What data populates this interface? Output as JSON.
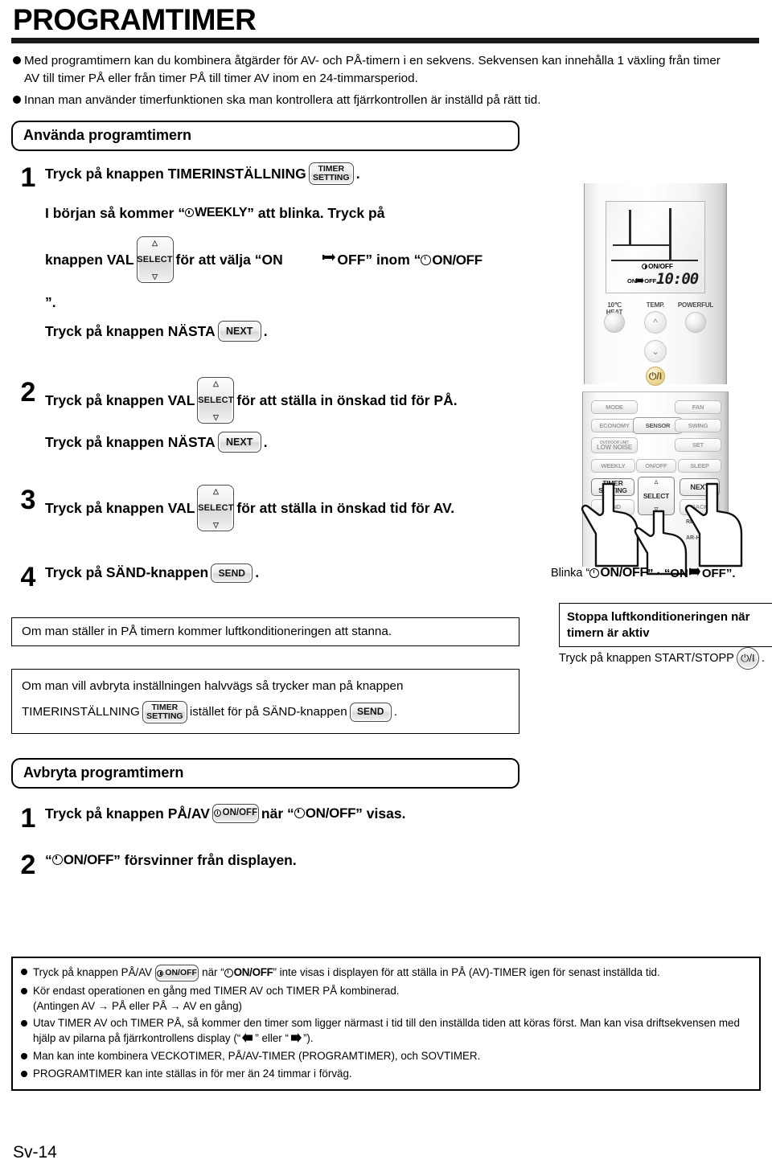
{
  "page": {
    "title": "PROGRAMTIMER",
    "footer": "Sv-14"
  },
  "intro": [
    "Med programtimern kan du kombinera åtgärder för AV- och PÅ-timern i en sekvens. Sekvensen kan innehålla 1 växling från timer AV till timer PÅ eller från timer PÅ till timer AV inom en 24-timmarsperiod.",
    "Innan man använder timerfunktionen ska man kontrollera att fjärrkontrollen är inställd på rätt tid."
  ],
  "use_section": {
    "heading": "Använda programtimern",
    "step1": {
      "num": "1",
      "line1_a": "Tryck på knappen TIMERINSTÄLLNING",
      "line1_b": ".",
      "line2_a": "I början så kommer “",
      "line2_weekly": "WEEKLY",
      "line2_b": "” att blinka. Tryck på",
      "line3_a": "knappen VAL",
      "line3_b": "för att välja “ON",
      "line3_c": "OFF” inom “",
      "line3_onoff": "ON/OFF",
      "line4": "”.",
      "line5_a": "Tryck på knappen NÄSTA",
      "line5_b": "."
    },
    "step2": {
      "num": "2",
      "line1_a": "Tryck på knappen VAL",
      "line1_b": "för att ställa in önskad tid för PÅ.",
      "line2_a": "Tryck på knappen NÄSTA",
      "line2_b": "."
    },
    "step3": {
      "num": "3",
      "line1_a": "Tryck på knappen VAL",
      "line1_b": "för att ställa in önskad tid för AV."
    },
    "step4": {
      "num": "4",
      "line1_a": "Tryck på SÄND-knappen",
      "line1_b": "."
    },
    "note_stop": "Om man ställer in PÅ timern kommer luftkonditioneringen att stanna.",
    "note_cancel_a": "Om man vill avbryta inställningen halvvägs så trycker man på knappen",
    "note_cancel_b": "TIMERINSTÄLLNING",
    "note_cancel_c": "istället för på SÄND-knappen",
    "note_cancel_d": "."
  },
  "right_panel": {
    "blinka_a": "Blinka “",
    "blinka_onoff": "ON/OFF",
    "blinka_b": "” · “ON",
    "blinka_c": "OFF”.",
    "stop_box_line1": "Stoppa luftkonditioneringen när",
    "stop_box_line2": "timern är aktiv",
    "start_stop_a": "Tryck på knappen START/STOPP",
    "start_stop_b": ".",
    "lcd": {
      "indicator_onoff": "ON/OFF",
      "mode_on": "ON",
      "mode_off": "OFF",
      "time": "10:00"
    },
    "remote_labels": {
      "heat10": "10℃ HEAT",
      "temp": "TEMP.",
      "powerful": "POWERFUL",
      "power_symbol": "⏻/I"
    },
    "buttons": [
      "MODE",
      "FAN",
      "ECONOMY",
      "SENSOR",
      "SWING",
      "OUTDOOR UNIT LOW NOISE",
      "SET",
      "WEEKLY",
      "ON/OFF",
      "SLEEP",
      "TIMER SETTING",
      "SELECT",
      "NEXT",
      "SEND",
      "BACK",
      "CLOCK ADJUST",
      "RESET",
      "AR-HG1"
    ],
    "button_rows": {
      "mode": "MODE",
      "fan": "FAN",
      "economy": "ECONOMY",
      "sensor": "SENSOR",
      "swing": "SWING",
      "low_noise_top": "OUTDOOR UNIT",
      "low_noise": "LOW NOISE",
      "set": "SET",
      "weekly": "WEEKLY",
      "onoff": "ON/OFF",
      "sleep": "SLEEP",
      "timer_setting_1": "TIMER",
      "timer_setting_2": "SETTING",
      "select": "SELECT",
      "next": "NEXT",
      "send": "SEND",
      "back": "BACK",
      "clock_adj": "CK AD",
      "reset": "RES",
      "model": "AR-H"
    }
  },
  "cancel_section": {
    "heading": "Avbryta programtimern",
    "step1": {
      "num": "1",
      "text_a": "Tryck på knappen PÅ/AV",
      "btn": "ON/OFF",
      "text_b": "när “",
      "onoff": "ON/OFF",
      "text_c": "” visas."
    },
    "step2": {
      "num": "2",
      "text_a": "“",
      "onoff": "ON/OFF",
      "text_b": "” försvinner från displayen."
    }
  },
  "notes": [
    {
      "a": "Tryck på knappen PÅ/AV",
      "btn": "ON/OFF",
      "b": "när “",
      "onoff": "ON/OFF",
      "c": "” inte visas i displayen för att ställa in PÅ (AV)-TIMER igen för senast inställda tid."
    },
    {
      "text": "Kör endast operationen en gång med TIMER AV och TIMER PÅ kombinerad.\n(Antingen AV → PÅ eller PÅ → AV en gång)"
    },
    {
      "a": "Utav TIMER AV och TIMER PÅ, så kommer den timer som ligger närmast i tid till den inställda tiden att köras först. Man kan visa driftsekvensen med hjälp av pilarna på fjärrkontrollens display (“",
      "b": "” eller “",
      "c": "”)."
    },
    {
      "text": "Man kan inte kombinera VECKOTIMER, PÅ/AV-TIMER (PROGRAMTIMER), och SOVTIMER."
    },
    {
      "text": "PROGRAMTIMER kan inte ställas in för mer än 24 timmar i förväg."
    }
  ]
}
